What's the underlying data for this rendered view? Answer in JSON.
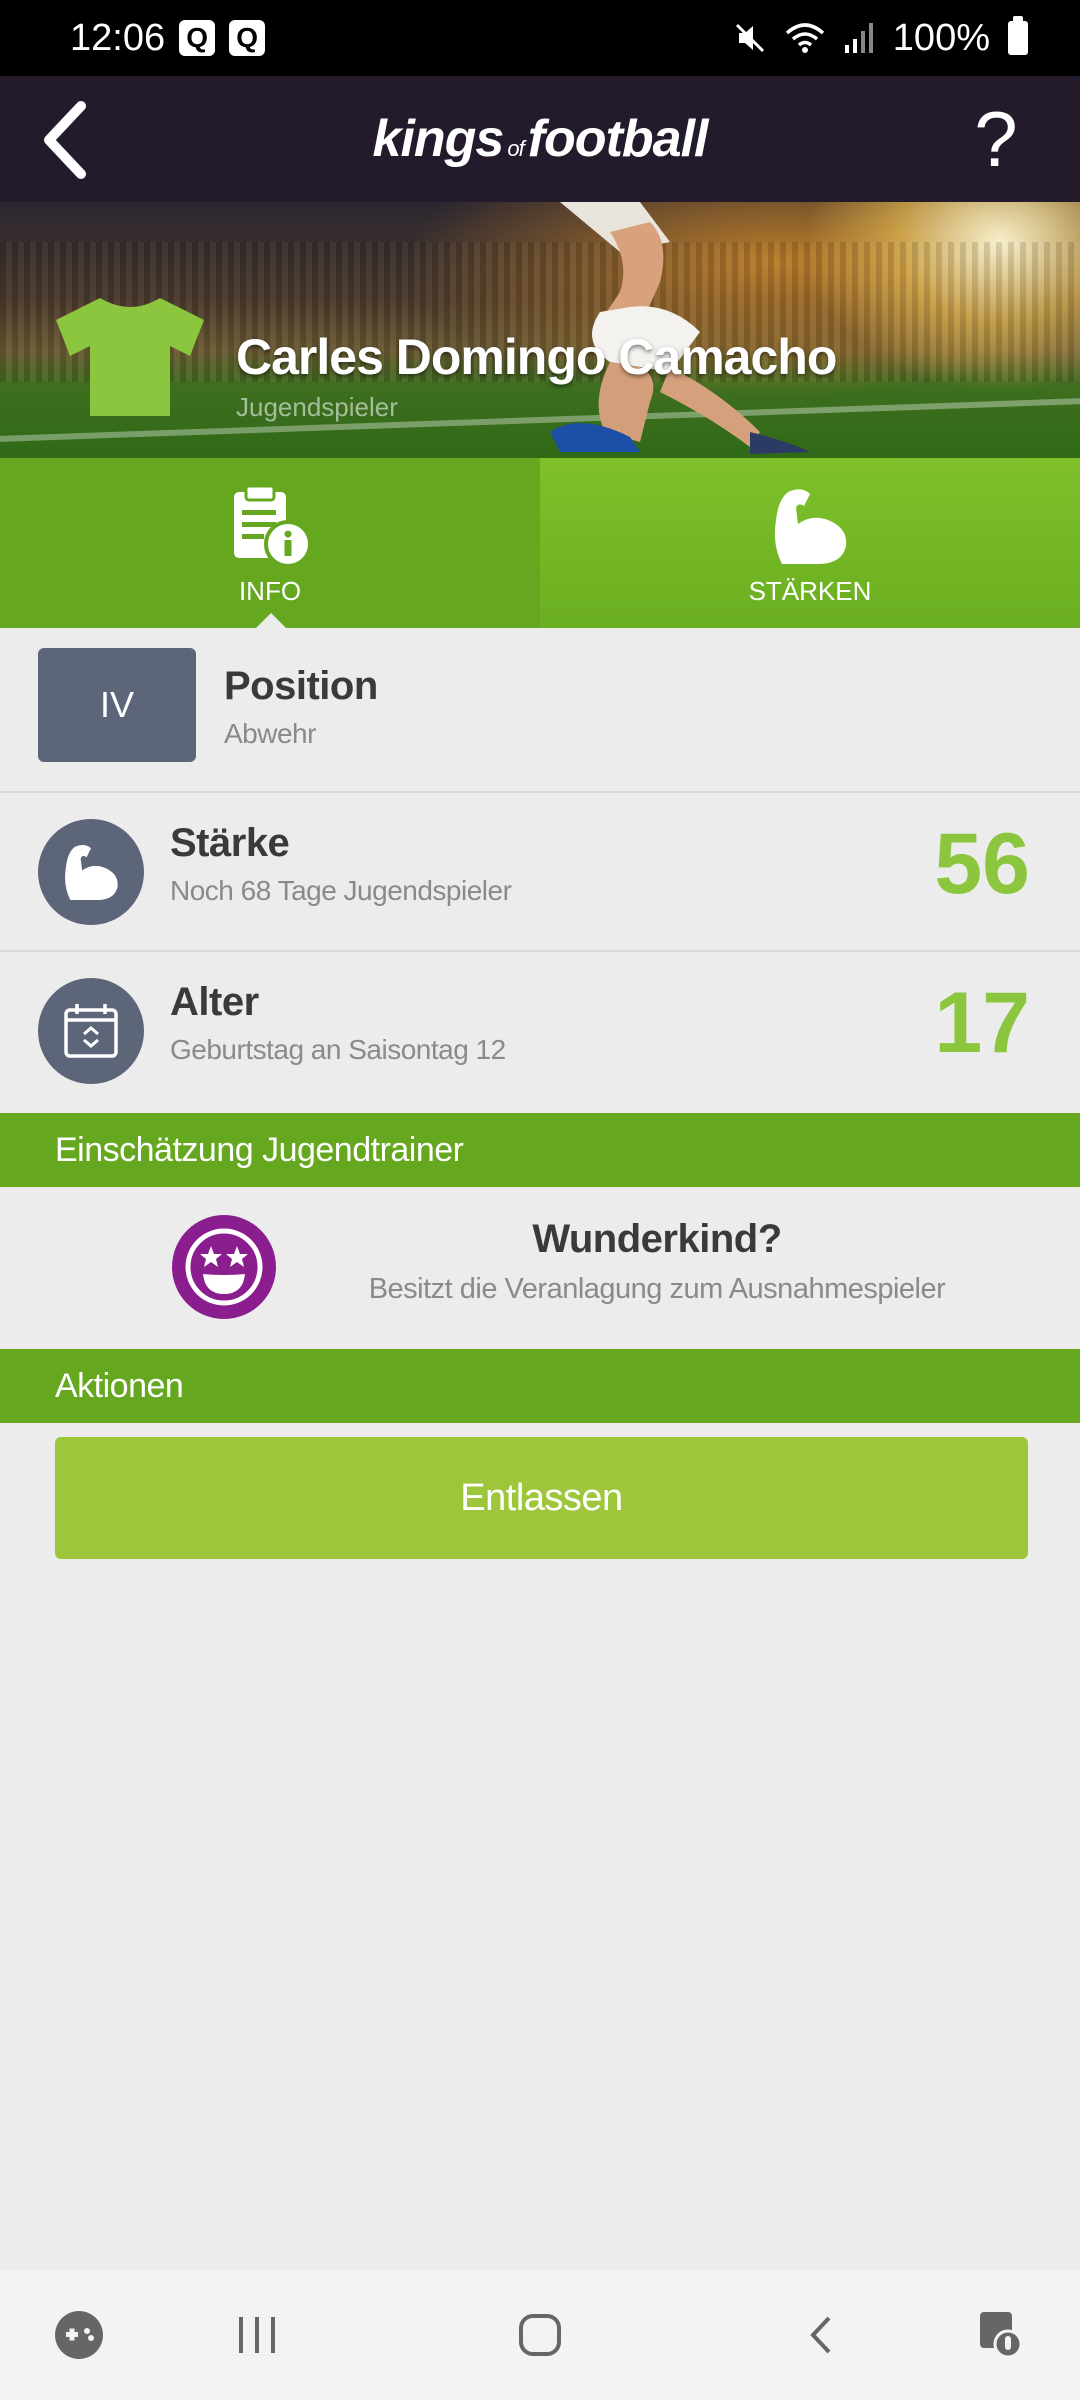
{
  "status_bar": {
    "time": "12:06",
    "notif_badges": [
      "Q",
      "Q"
    ],
    "battery": "100%",
    "icons": [
      "mute-icon",
      "wifi-icon",
      "signal-icon",
      "battery-icon"
    ]
  },
  "header": {
    "logo_left": "kings",
    "logo_mid": "of",
    "logo_right": "football",
    "help_label": "?",
    "back_icon": "chevron-left-icon"
  },
  "player": {
    "name": "Carles Domingo Camacho",
    "subtitle": "Jugendspieler",
    "shirt_color": "#8cc63f"
  },
  "tabs": [
    {
      "label": "INFO",
      "icon": "info-document-icon",
      "active": true
    },
    {
      "label": "STÄRKEN",
      "icon": "bicep-icon",
      "active": false
    }
  ],
  "position": {
    "badge": "IV",
    "title": "Position",
    "subtitle": "Abwehr"
  },
  "staerke": {
    "title": "Stärke",
    "subtitle": "Noch 68 Tage Jugendspieler",
    "value": "56"
  },
  "alter": {
    "title": "Alter",
    "subtitle": "Geburtstag an Saisontag 12",
    "value": "17"
  },
  "coach_section": {
    "header": "Einschätzung Jugendtrainer",
    "title": "Wunderkind?",
    "subtitle": "Besitzt die Veranlagung zum Ausnahmespieler",
    "icon": "star-eyes-smiley-icon",
    "icon_color": "#8b1e8e"
  },
  "actions_section": {
    "header": "Aktionen",
    "button_label": "Entlassen"
  },
  "colors": {
    "header_bg": "#231b2b",
    "green_dark": "#65a81f",
    "green_light": "#9ec63b",
    "value_green": "#8cc63f",
    "badge_gray": "#5d6579"
  },
  "nav_bar": {
    "items": [
      "game-launcher-icon",
      "recent-apps-icon",
      "home-icon",
      "back-icon",
      "screen-assist-icon"
    ]
  }
}
